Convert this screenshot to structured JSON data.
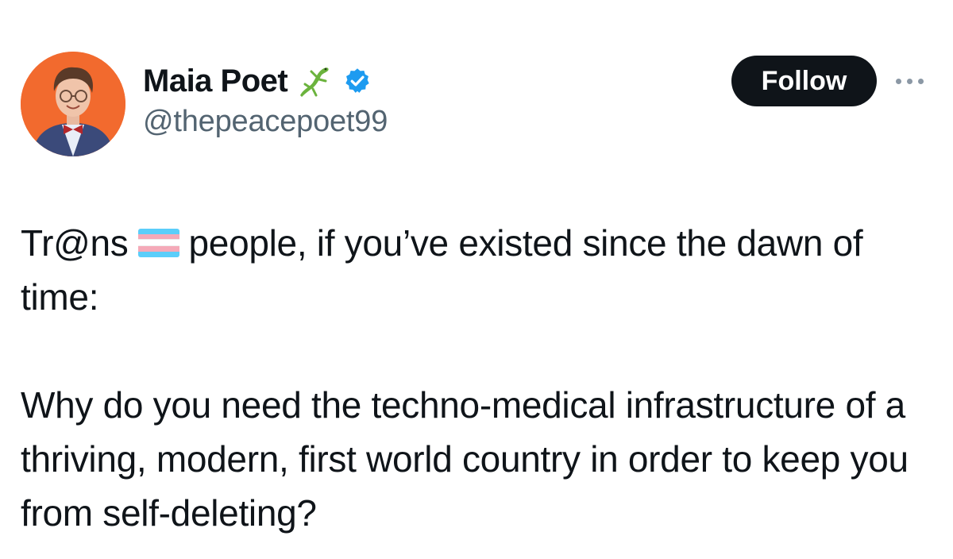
{
  "author": {
    "display_name": "Maia Poet",
    "handle": "@thepeacepoet99",
    "name_emoji": "lizard-icon",
    "verified": true,
    "avatar_bg": "#f26a2e"
  },
  "actions": {
    "follow_label": "Follow",
    "more": "more-icon"
  },
  "tweet": {
    "text_part1": "Tr@ns",
    "inline_flag": "transgender-flag-icon",
    "text_part2": "people, if you’ve existed since the dawn of time:",
    "paragraph2": "Why do you need the techno-medical infrastructure of a thriving, modern, first world country in order to keep you from self-deleting?"
  },
  "colors": {
    "text": "#0f1419",
    "secondary_text": "#536471",
    "follow_bg": "#0f1419",
    "verified_blue": "#1d9bf0",
    "flag_blue": "#5bcefa",
    "flag_pink": "#f5a9b8",
    "flag_white": "#ffffff"
  }
}
